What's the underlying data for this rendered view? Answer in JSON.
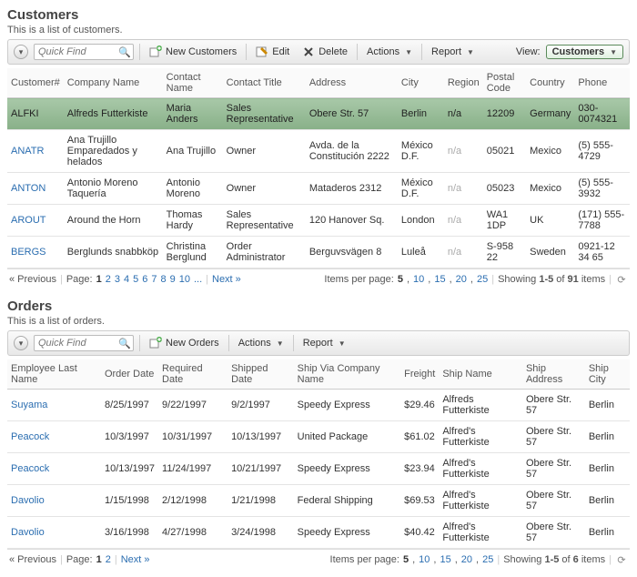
{
  "customers": {
    "title": "Customers",
    "subtitle": "This is a list of customers.",
    "search_placeholder": "Quick Find",
    "toolbar": {
      "new": "New Customers",
      "edit": "Edit",
      "delete": "Delete",
      "actions": "Actions",
      "report": "Report",
      "view_label": "View:",
      "view_value": "Customers"
    },
    "columns": [
      "Customer#",
      "Company Name",
      "Contact Name",
      "Contact Title",
      "Address",
      "City",
      "Region",
      "Postal Code",
      "Country",
      "Phone"
    ],
    "rows": [
      {
        "id": "ALFKI",
        "company": "Alfreds Futterkiste",
        "contact": "Maria Anders",
        "title": "Sales Representative",
        "address": "Obere Str. 57",
        "city": "Berlin",
        "region": "n/a",
        "postal": "12209",
        "country": "Germany",
        "phone": "030-0074321",
        "selected": true
      },
      {
        "id": "ANATR",
        "company": "Ana Trujillo Emparedados y helados",
        "contact": "Ana Trujillo",
        "title": "Owner",
        "address": "Avda. de la Constitución 2222",
        "city": "México D.F.",
        "region": "n/a",
        "postal": "05021",
        "country": "Mexico",
        "phone": "(5) 555-4729"
      },
      {
        "id": "ANTON",
        "company": "Antonio Moreno Taquería",
        "contact": "Antonio Moreno",
        "title": "Owner",
        "address": "Mataderos 2312",
        "city": "México D.F.",
        "region": "n/a",
        "postal": "05023",
        "country": "Mexico",
        "phone": "(5) 555-3932"
      },
      {
        "id": "AROUT",
        "company": "Around the Horn",
        "contact": "Thomas Hardy",
        "title": "Sales Representative",
        "address": "120 Hanover Sq.",
        "city": "London",
        "region": "n/a",
        "postal": "WA1 1DP",
        "country": "UK",
        "phone": "(171) 555-7788"
      },
      {
        "id": "BERGS",
        "company": "Berglunds snabbköp",
        "contact": "Christina Berglund",
        "title": "Order Administrator",
        "address": "Berguvsvägen 8",
        "city": "Luleå",
        "region": "n/a",
        "postal": "S-958 22",
        "country": "Sweden",
        "phone": "0921-12 34 65"
      }
    ],
    "pager": {
      "previous": "« Previous",
      "page_label": "Page:",
      "pages": [
        "1",
        "2",
        "3",
        "4",
        "5",
        "6",
        "7",
        "8",
        "9",
        "10",
        "..."
      ],
      "next": "Next »",
      "ipp_label": "Items per page:",
      "ipp_opts": [
        "5",
        "10",
        "15",
        "20",
        "25"
      ],
      "showing_pre": "Showing ",
      "showing_range": "1-5",
      "showing_mid": " of ",
      "showing_total": "91",
      "showing_post": " items"
    }
  },
  "orders": {
    "title": "Orders",
    "subtitle": "This is a list of orders.",
    "search_placeholder": "Quick Find",
    "toolbar": {
      "new": "New Orders",
      "actions": "Actions",
      "report": "Report"
    },
    "columns": [
      "Employee Last Name",
      "Order Date",
      "Required Date",
      "Shipped Date",
      "Ship Via Company Name",
      "Freight",
      "Ship Name",
      "Ship Address",
      "Ship City"
    ],
    "rows": [
      {
        "emp": "Suyama",
        "order": "8/25/1997",
        "req": "9/22/1997",
        "ship": "9/2/1997",
        "via": "Speedy Express",
        "freight": "$29.46",
        "name": "Alfreds Futterkiste",
        "addr": "Obere Str. 57",
        "city": "Berlin"
      },
      {
        "emp": "Peacock",
        "order": "10/3/1997",
        "req": "10/31/1997",
        "ship": "10/13/1997",
        "via": "United Package",
        "freight": "$61.02",
        "name": "Alfred's Futterkiste",
        "addr": "Obere Str. 57",
        "city": "Berlin"
      },
      {
        "emp": "Peacock",
        "order": "10/13/1997",
        "req": "11/24/1997",
        "ship": "10/21/1997",
        "via": "Speedy Express",
        "freight": "$23.94",
        "name": "Alfred's Futterkiste",
        "addr": "Obere Str. 57",
        "city": "Berlin"
      },
      {
        "emp": "Davolio",
        "order": "1/15/1998",
        "req": "2/12/1998",
        "ship": "1/21/1998",
        "via": "Federal Shipping",
        "freight": "$69.53",
        "name": "Alfred's Futterkiste",
        "addr": "Obere Str. 57",
        "city": "Berlin"
      },
      {
        "emp": "Davolio",
        "order": "3/16/1998",
        "req": "4/27/1998",
        "ship": "3/24/1998",
        "via": "Speedy Express",
        "freight": "$40.42",
        "name": "Alfred's Futterkiste",
        "addr": "Obere Str. 57",
        "city": "Berlin"
      }
    ],
    "pager": {
      "previous": "« Previous",
      "page_label": "Page:",
      "pages": [
        "1",
        "2"
      ],
      "next": "Next »",
      "ipp_label": "Items per page:",
      "ipp_opts": [
        "5",
        "10",
        "15",
        "20",
        "25"
      ],
      "showing_pre": "Showing ",
      "showing_range": "1-5",
      "showing_mid": " of ",
      "showing_total": "6",
      "showing_post": " items"
    }
  }
}
